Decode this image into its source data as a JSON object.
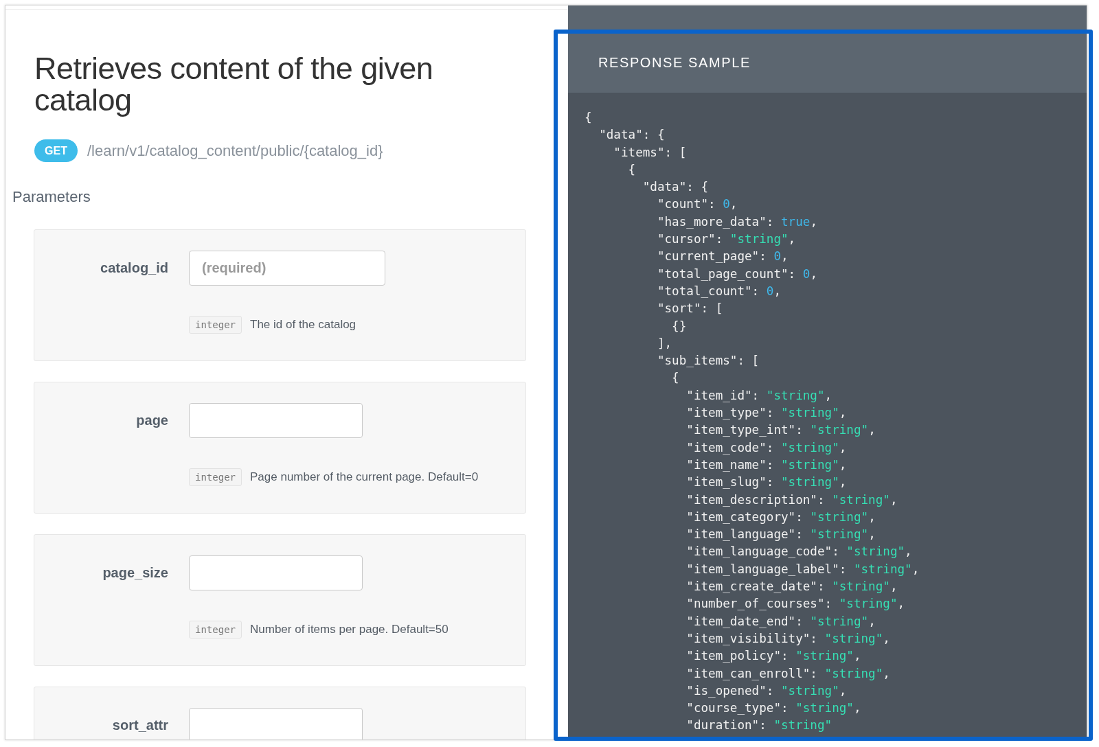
{
  "endpoint": {
    "title": "Retrieves content of the given catalog",
    "method": "GET",
    "path": "/learn/v1/catalog_content/public/{catalog_id}"
  },
  "parameters": {
    "heading": "Parameters",
    "items": [
      {
        "name": "catalog_id",
        "placeholder": "(required)",
        "type": "integer",
        "description": "The id of the catalog"
      },
      {
        "name": "page",
        "type": "integer",
        "description": "Page number of the current page. Default=0"
      },
      {
        "name": "page_size",
        "type": "integer",
        "description": "Number of items per page. Default=50"
      },
      {
        "name": "sort_attr"
      }
    ]
  },
  "response_sample": {
    "title": "RESPONSE SAMPLE",
    "highlighted": true,
    "lines": [
      {
        "text": "{"
      },
      {
        "text": "  \"data\": {"
      },
      {
        "text": "    \"items\": ["
      },
      {
        "text": "      {"
      },
      {
        "text": "        \"data\": {"
      },
      {
        "text": "          \"count\": ",
        "value": "0",
        "kind": "number",
        "tail": ","
      },
      {
        "text": "          \"has_more_data\": ",
        "value": "true",
        "kind": "boolean",
        "tail": ","
      },
      {
        "text": "          \"cursor\": ",
        "value": "\"string\"",
        "kind": "string",
        "tail": ","
      },
      {
        "text": "          \"current_page\": ",
        "value": "0",
        "kind": "number",
        "tail": ","
      },
      {
        "text": "          \"total_page_count\": ",
        "value": "0",
        "kind": "number",
        "tail": ","
      },
      {
        "text": "          \"total_count\": ",
        "value": "0",
        "kind": "number",
        "tail": ","
      },
      {
        "text": "          \"sort\": ["
      },
      {
        "text": "            {}"
      },
      {
        "text": "          ],"
      },
      {
        "text": "          \"sub_items\": ["
      },
      {
        "text": "            {"
      },
      {
        "text": "              \"item_id\": ",
        "value": "\"string\"",
        "kind": "string",
        "tail": ","
      },
      {
        "text": "              \"item_type\": ",
        "value": "\"string\"",
        "kind": "string",
        "tail": ","
      },
      {
        "text": "              \"item_type_int\": ",
        "value": "\"string\"",
        "kind": "string",
        "tail": ","
      },
      {
        "text": "              \"item_code\": ",
        "value": "\"string\"",
        "kind": "string",
        "tail": ","
      },
      {
        "text": "              \"item_name\": ",
        "value": "\"string\"",
        "kind": "string",
        "tail": ","
      },
      {
        "text": "              \"item_slug\": ",
        "value": "\"string\"",
        "kind": "string",
        "tail": ","
      },
      {
        "text": "              \"item_description\": ",
        "value": "\"string\"",
        "kind": "string",
        "tail": ","
      },
      {
        "text": "              \"item_category\": ",
        "value": "\"string\"",
        "kind": "string",
        "tail": ","
      },
      {
        "text": "              \"item_language\": ",
        "value": "\"string\"",
        "kind": "string",
        "tail": ","
      },
      {
        "text": "              \"item_language_code\": ",
        "value": "\"string\"",
        "kind": "string",
        "tail": ","
      },
      {
        "text": "              \"item_language_label\": ",
        "value": "\"string\"",
        "kind": "string",
        "tail": ","
      },
      {
        "text": "              \"item_create_date\": ",
        "value": "\"string\"",
        "kind": "string",
        "tail": ","
      },
      {
        "text": "              \"number_of_courses\": ",
        "value": "\"string\"",
        "kind": "string",
        "tail": ","
      },
      {
        "text": "              \"item_date_end\": ",
        "value": "\"string\"",
        "kind": "string",
        "tail": ","
      },
      {
        "text": "              \"item_visibility\": ",
        "value": "\"string\"",
        "kind": "string",
        "tail": ","
      },
      {
        "text": "              \"item_policy\": ",
        "value": "\"string\"",
        "kind": "string",
        "tail": ","
      },
      {
        "text": "              \"item_can_enroll\": ",
        "value": "\"string\"",
        "kind": "string",
        "tail": ","
      },
      {
        "text": "              \"is_opened\": ",
        "value": "\"string\"",
        "kind": "string",
        "tail": ","
      },
      {
        "text": "              \"course_type\": ",
        "value": "\"string\"",
        "kind": "string",
        "tail": ","
      },
      {
        "text": "              \"duration\": ",
        "value": "\"string\"",
        "kind": "string"
      }
    ]
  }
}
